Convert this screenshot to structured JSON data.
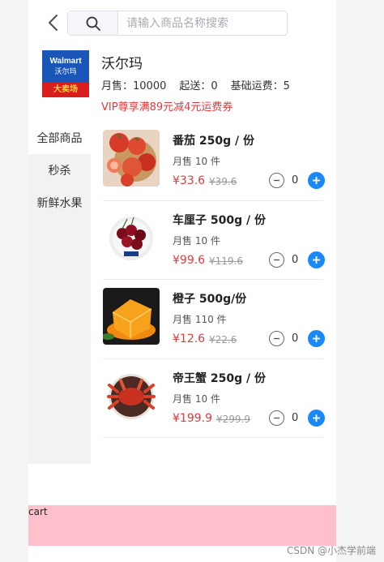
{
  "search": {
    "placeholder": "请输入商品名称搜索"
  },
  "icons": {
    "back": "chevron-left-icon",
    "search": "search-icon",
    "minus": "minus-circle-icon",
    "plus": "plus-circle-icon"
  },
  "shop": {
    "name": "沃尔玛",
    "logo_brand": "Walmart",
    "logo_cn": "沃尔玛",
    "logo_ribbon": "大卖场",
    "sales_label": "月售：10000",
    "min_order_label": "起送：0",
    "delivery_fee_label": "基础运费：5",
    "promo": "VIP尊享满89元减4元运费券"
  },
  "categories": [
    {
      "label": "全部商品",
      "active": true
    },
    {
      "label": "秒杀",
      "active": false
    },
    {
      "label": "新鲜水果",
      "active": false
    }
  ],
  "goods": [
    {
      "name": "番茄 250g / 份",
      "sales": "月售 10 件",
      "price": "¥33.6",
      "old_price": "¥39.6",
      "qty": "0",
      "image": "tomato"
    },
    {
      "name": "车厘子 500g / 份",
      "sales": "月售 10 件",
      "price": "¥99.6",
      "old_price": "¥119.6",
      "qty": "0",
      "image": "cherry"
    },
    {
      "name": "橙子 500g/份",
      "sales": "月售 110 件",
      "price": "¥12.6",
      "old_price": "¥22.6",
      "qty": "0",
      "image": "orange"
    },
    {
      "name": "帝王蟹 250g / 份",
      "sales": "月售 10 件",
      "price": "¥199.9",
      "old_price": "¥299.9",
      "qty": "0",
      "image": "crab"
    }
  ],
  "cart": {
    "label": "cart"
  },
  "watermark": "CSDN @小杰学前端",
  "colors": {
    "accent": "#1989fa",
    "price": "#e4393c",
    "cart_bg": "#ffc0cb",
    "walmart_blue": "#1a56b8"
  }
}
